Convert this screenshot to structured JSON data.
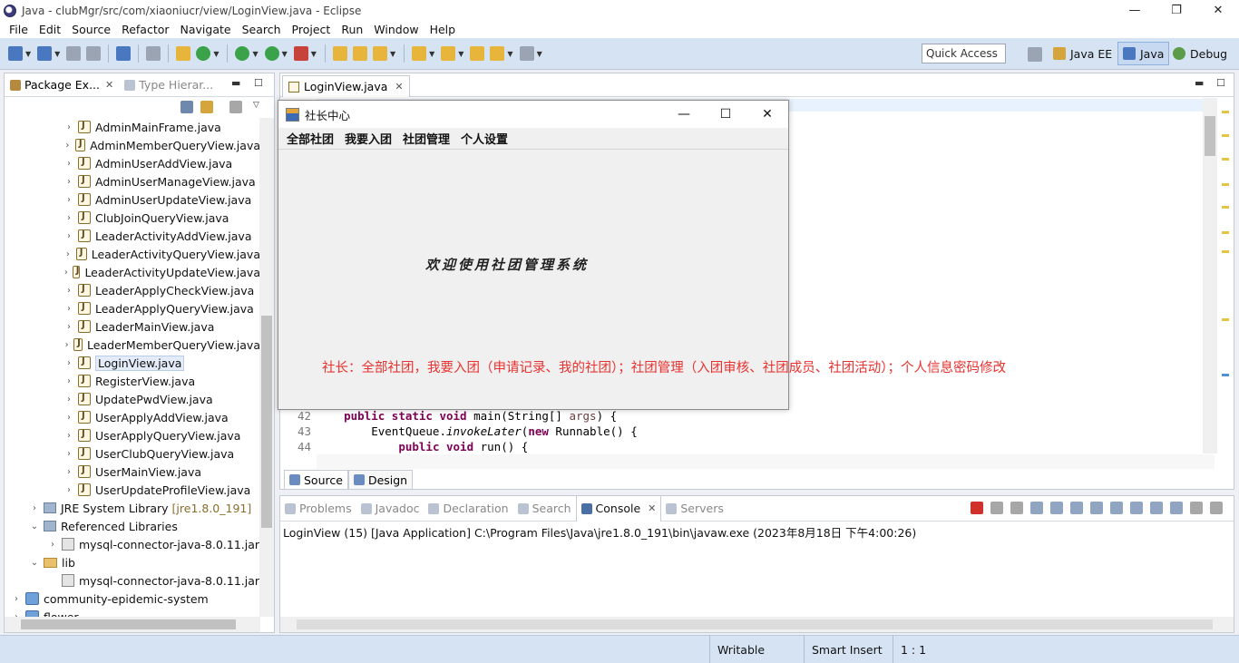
{
  "window": {
    "title": "Java - clubMgr/src/com/xiaoniucr/view/LoginView.java - Eclipse",
    "min": "—",
    "max": "❐",
    "close": "✕"
  },
  "menubar": [
    "File",
    "Edit",
    "Source",
    "Refactor",
    "Navigate",
    "Search",
    "Project",
    "Run",
    "Window",
    "Help"
  ],
  "toolbar": {
    "quick_access": "Quick Access",
    "perspectives": [
      "Java EE",
      "Java",
      "Debug"
    ]
  },
  "package_explorer": {
    "tab_active": "Package Ex...",
    "tab_inactive": "Type Hierar...",
    "files": [
      "AdminMainFrame.java",
      "AdminMemberQueryView.java",
      "AdminUserAddView.java",
      "AdminUserManageView.java",
      "AdminUserUpdateView.java",
      "ClubJoinQueryView.java",
      "LeaderActivityAddView.java",
      "LeaderActivityQueryView.java",
      "LeaderActivityUpdateView.java",
      "LeaderApplyCheckView.java",
      "LeaderApplyQueryView.java",
      "LeaderMainView.java",
      "LeaderMemberQueryView.java",
      "LoginView.java",
      "RegisterView.java",
      "UpdatePwdView.java",
      "UserApplyAddView.java",
      "UserApplyQueryView.java",
      "UserClubQueryView.java",
      "UserMainView.java",
      "UserUpdateProfileView.java"
    ],
    "selected": "LoginView.java",
    "jre_label": "JRE System Library",
    "jre_suffix": "[jre1.8.0_191]",
    "ref_libs": "Referenced Libraries",
    "mysql_jar": "mysql-connector-java-8.0.11.jar",
    "lib": "lib",
    "lib_jar": "mysql-connector-java-8.0.11.jar",
    "project1": "community-epidemic-system",
    "project2": "flower"
  },
  "editor": {
    "tab": "LoginView.java",
    "lines": [
      {
        "n": "42",
        "pre": "    ",
        "kw1": "public static void",
        "rest": " main(String[] ",
        "pv": "args",
        "end": ") {"
      },
      {
        "n": "43",
        "pre": "        EventQueue.",
        "it": "invokeLater",
        "mid": "(",
        "kw": "new",
        "rest": " Runnable() {"
      },
      {
        "n": "44",
        "pre": "            ",
        "kw1": "public void",
        "rest": " run() {"
      }
    ],
    "bottom_tabs": [
      "Source",
      "Design"
    ]
  },
  "console": {
    "tabs": [
      "Problems",
      "Javadoc",
      "Declaration",
      "Search",
      "Console",
      "Servers"
    ],
    "active": "Console",
    "status": "LoginView (15) [Java Application] C:\\Program Files\\Java\\jre1.8.0_191\\bin\\javaw.exe (2023年8月18日 下午4:00:26)"
  },
  "statusbar": {
    "writable": "Writable",
    "insert": "Smart Insert",
    "position": "1 : 1"
  },
  "swing_window": {
    "title": "社长中心",
    "menus": [
      "全部社团",
      "我要入团",
      "社团管理",
      "个人设置"
    ],
    "welcome": "欢迎使用社团管理系统"
  },
  "annotation": "社长：全部社团，我要入团（申请记录、我的社团）；社团管理（入团审核、社团成员、社团活动）；个人信息密码修改"
}
